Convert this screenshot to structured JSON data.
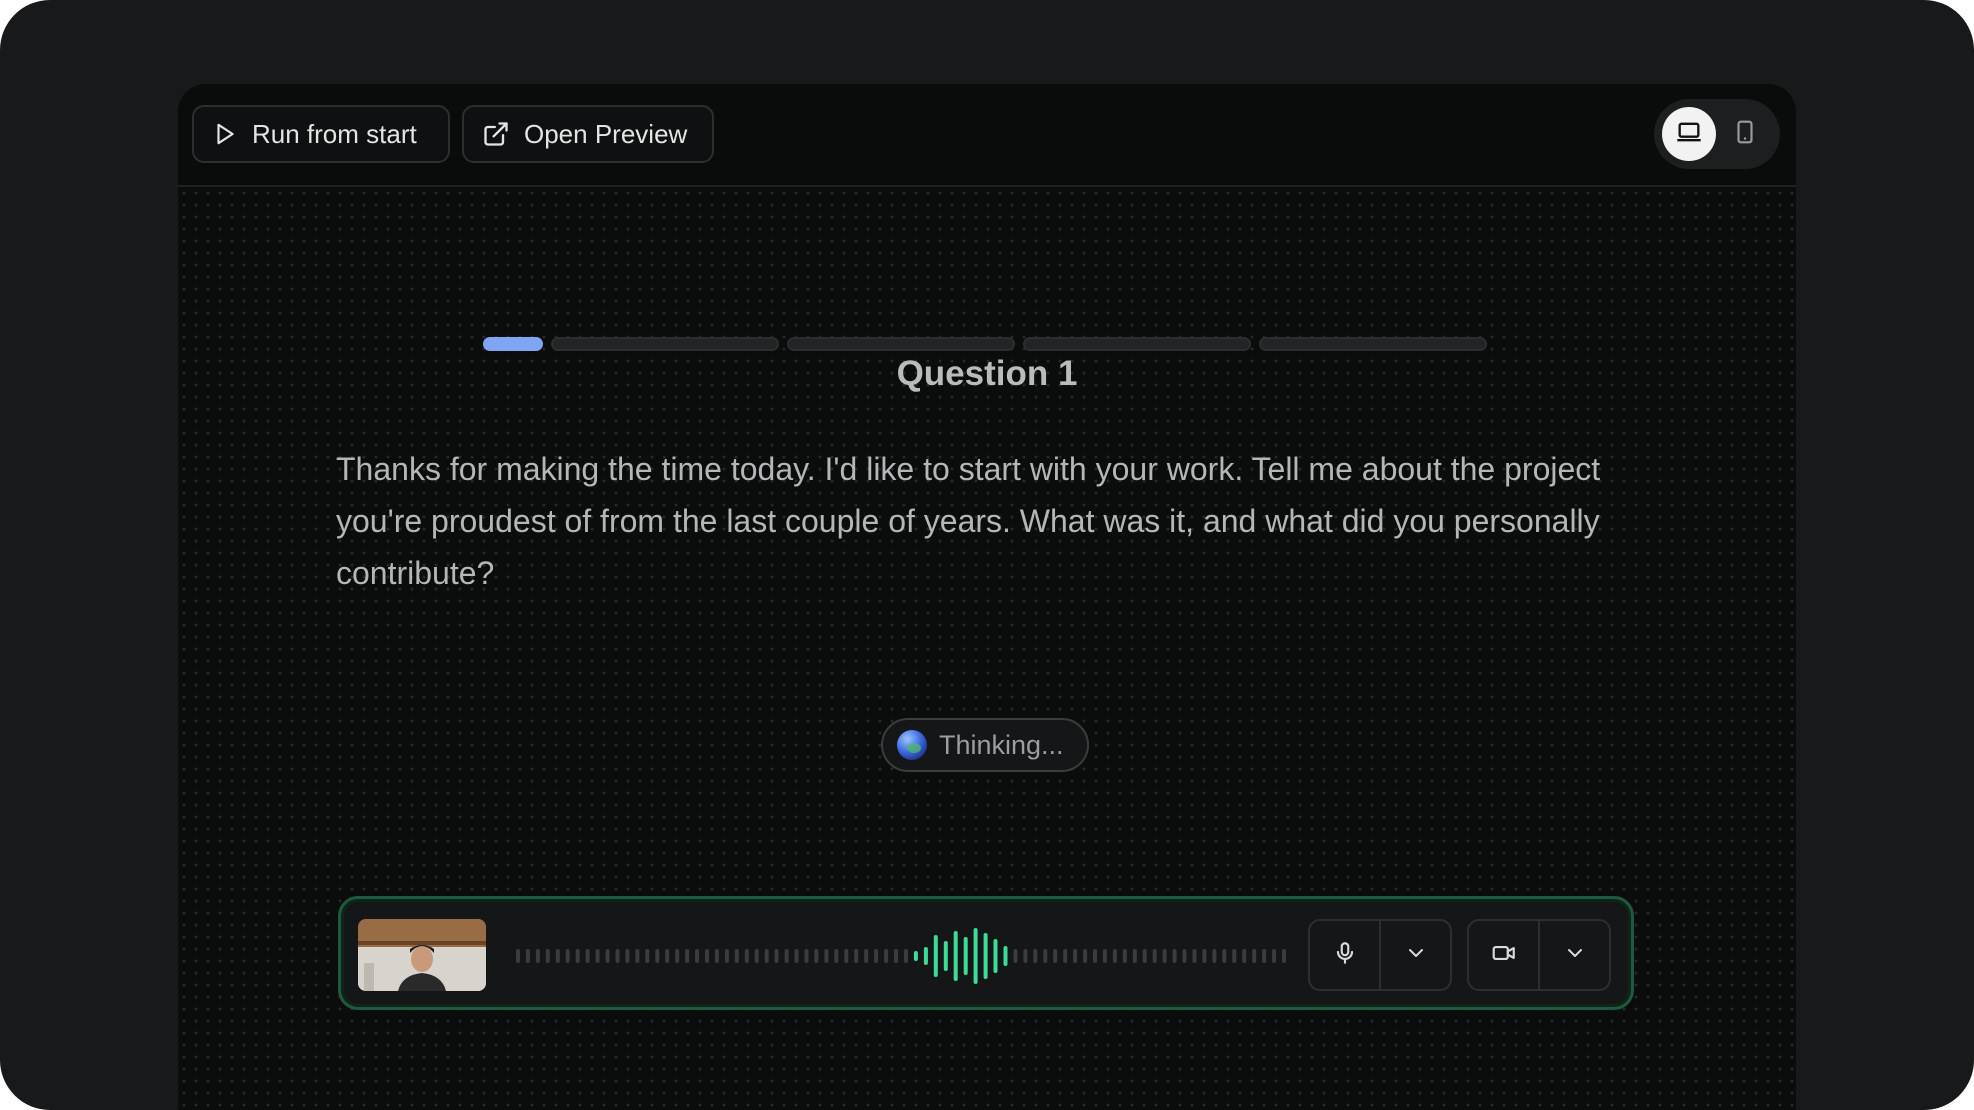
{
  "toolbar": {
    "run_label": "Run from start",
    "preview_label": "Open Preview"
  },
  "device_toggle": {
    "options": [
      "desktop-icon",
      "mobile-icon"
    ],
    "selected": "desktop"
  },
  "progress": {
    "total_steps": 5,
    "current_step": 1,
    "active_color": "#7ea6f2"
  },
  "question": {
    "title": "Question 1",
    "text": "Thanks for making the time today. I'd like to start with your work. Tell me about the project you're proudest of from the last couple of years. What was it, and what did you personally contribute?"
  },
  "status": {
    "label": "Thinking..."
  },
  "media": {
    "accent_color": "#3ddc97",
    "mic_icon": "mic-icon",
    "camera_icon": "video-camera-icon"
  }
}
